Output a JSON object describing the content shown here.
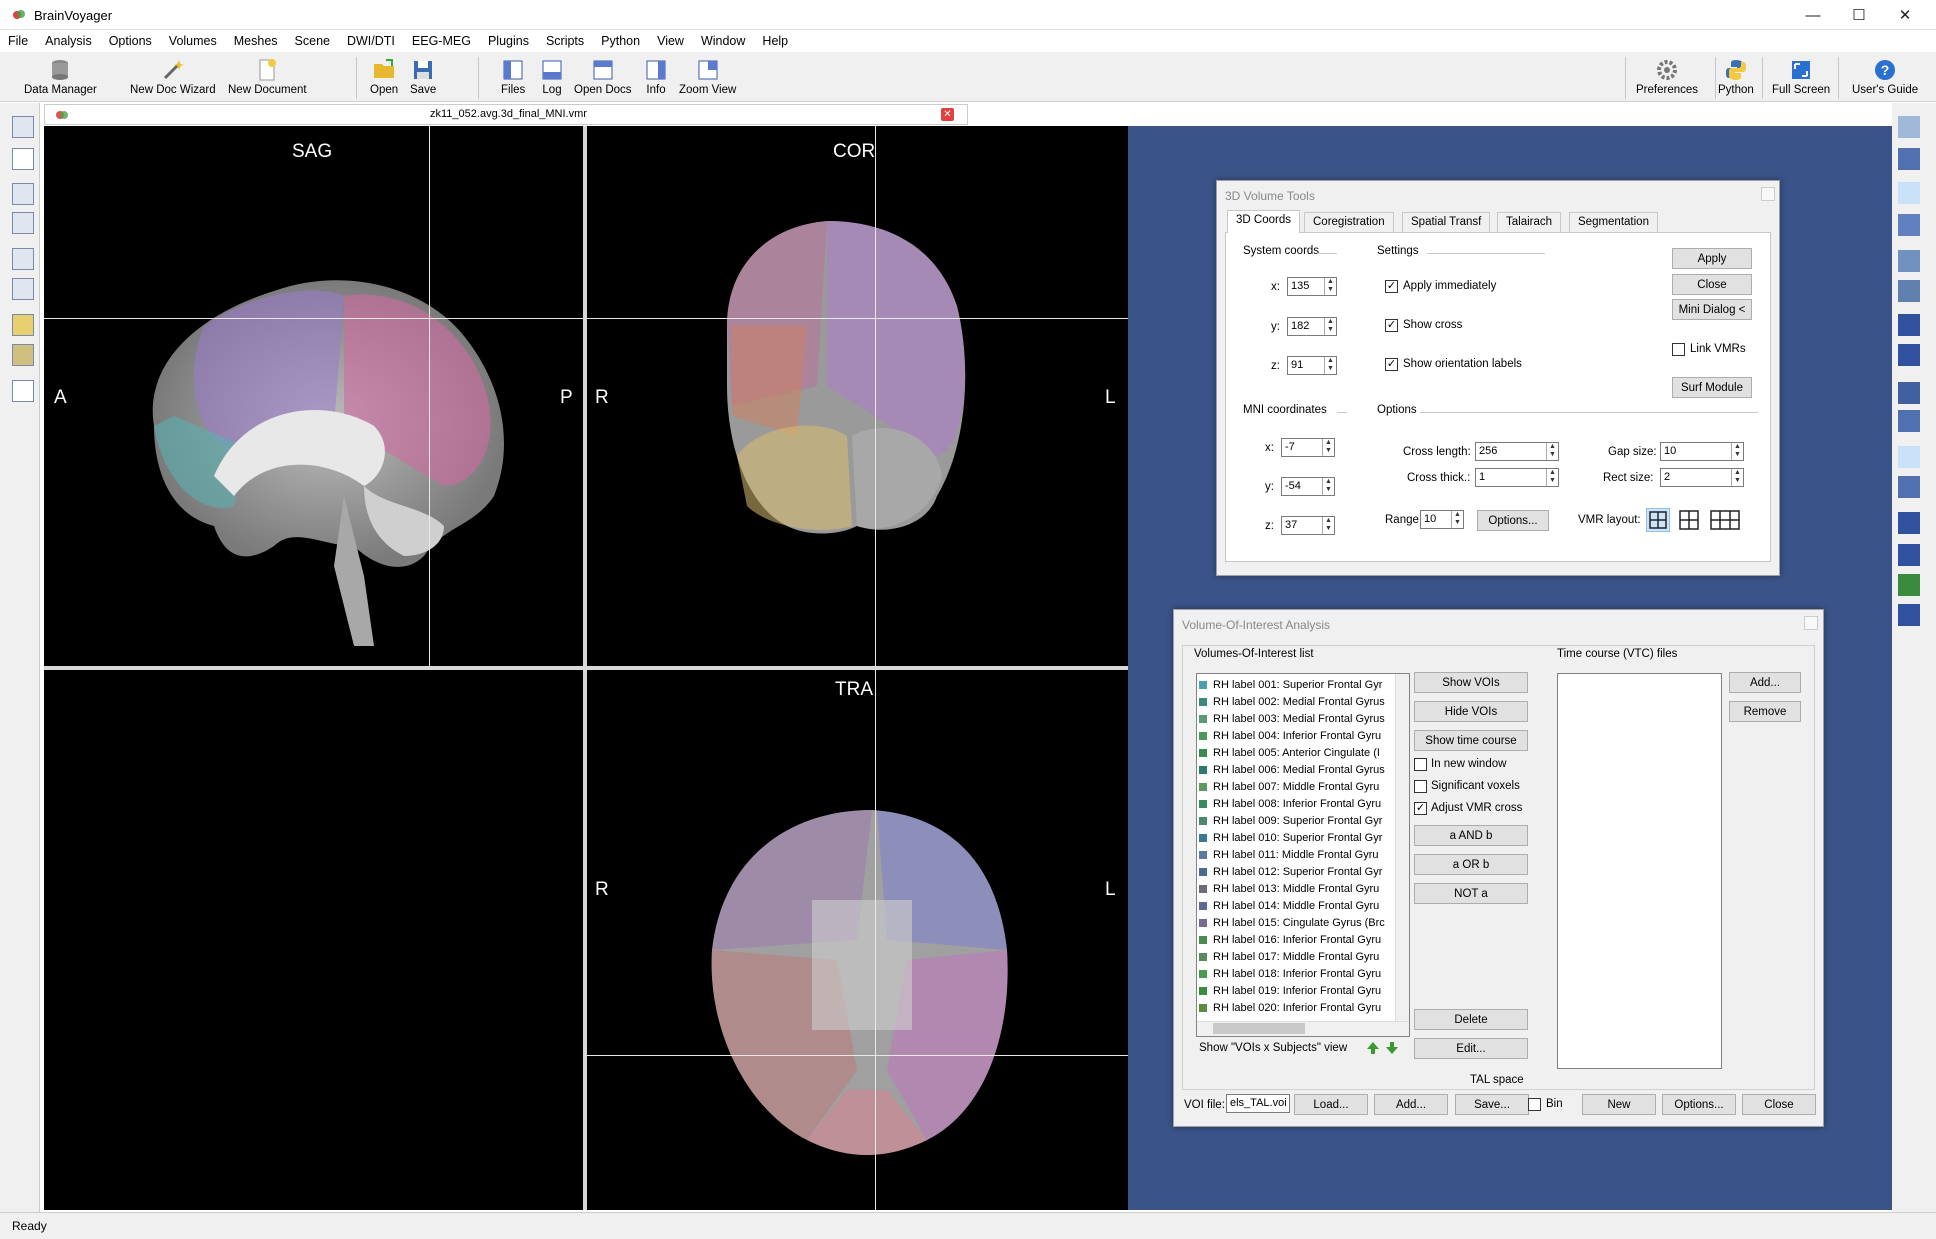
{
  "app": {
    "title": "BrainVoyager"
  },
  "window_controls": {
    "minimize": "—",
    "maximize": "☐",
    "close": "✕"
  },
  "menu": [
    "File",
    "Analysis",
    "Options",
    "Volumes",
    "Meshes",
    "Scene",
    "DWI/DTI",
    "EEG-MEG",
    "Plugins",
    "Scripts",
    "Python",
    "View",
    "Window",
    "Help"
  ],
  "toolbar": {
    "data_manager": "Data Manager",
    "new_doc_wizard": "New Doc Wizard",
    "new_document": "New Document",
    "open": "Open",
    "save": "Save",
    "files": "Files",
    "log": "Log",
    "open_docs": "Open Docs",
    "info": "Info",
    "zoom_view": "Zoom View",
    "preferences": "Preferences",
    "python": "Python",
    "full_screen": "Full Screen",
    "users_guide": "User's Guide"
  },
  "document": {
    "tab_title": "zk11_052.avg.3d_final_MNI.vmr"
  },
  "views": {
    "sag": {
      "title": "SAG",
      "left": "A",
      "right": "P"
    },
    "cor": {
      "title": "COR",
      "left": "R",
      "right": "L"
    },
    "tra": {
      "title": "TRA",
      "left": "R",
      "right": "L"
    }
  },
  "volume_tools": {
    "title": "3D Volume Tools",
    "tabs": [
      "3D Coords",
      "Coregistration",
      "Spatial Transf",
      "Talairach",
      "Segmentation"
    ],
    "active_tab": "3D Coords",
    "system_coords_label": "System coords",
    "settings_label": "Settings",
    "sys": {
      "x_label": "x:",
      "x": "135",
      "y_label": "y:",
      "y": "182",
      "z_label": "z:",
      "z": "91"
    },
    "apply_immediately": "Apply immediately",
    "show_cross": "Show cross",
    "show_orientation_labels": "Show orientation labels",
    "apply": "Apply",
    "close": "Close",
    "mini_dialog": "Mini Dialog <",
    "link_vmrs": "Link VMRs",
    "surf_module": "Surf Module",
    "mni_label": "MNI coordinates",
    "options_label": "Options",
    "mni": {
      "x_label": "x:",
      "x": "-7",
      "y_label": "y:",
      "y": "-54",
      "z_label": "z:",
      "z": "37"
    },
    "cross_length_label": "Cross length:",
    "cross_length": "256",
    "cross_thick_label": "Cross thick.:",
    "cross_thick": "1",
    "gap_size_label": "Gap size:",
    "gap_size": "10",
    "rect_size_label": "Rect size:",
    "rect_size": "2",
    "range_label": "Range:",
    "range": "10",
    "options_button": "Options...",
    "vmr_layout_label": "VMR layout:"
  },
  "voi_analysis": {
    "title": "Volume-Of-Interest Analysis",
    "voi_list_label": "Volumes-Of-Interest list",
    "tc_label": "Time course (VTC) files",
    "vois": [
      {
        "label": "RH label 001: Superior Frontal Gyr",
        "color": "#4aa0b0"
      },
      {
        "label": "RH label 002: Medial Frontal Gyrus",
        "color": "#3a8a80"
      },
      {
        "label": "RH label 003: Medial Frontal Gyrus",
        "color": "#5a9a70"
      },
      {
        "label": "RH label 004: Inferior Frontal Gyru",
        "color": "#4a9a60"
      },
      {
        "label": "RH label 005: Anterior Cingulate (I",
        "color": "#3a8a50"
      },
      {
        "label": "RH label 006: Medial Frontal Gyrus",
        "color": "#2a7a70"
      },
      {
        "label": "RH label 007: Middle Frontal Gyru",
        "color": "#5a9a60"
      },
      {
        "label": "RH label 008: Inferior Frontal Gyru",
        "color": "#3a8a60"
      },
      {
        "label": "RH label 009: Superior Frontal Gyr",
        "color": "#4a8a70"
      },
      {
        "label": "RH label 010: Superior Frontal Gyr",
        "color": "#3a7a90"
      },
      {
        "label": "RH label 011: Middle Frontal Gyru",
        "color": "#5a7aa0"
      },
      {
        "label": "RH label 012: Superior Frontal Gyr",
        "color": "#4a6a90"
      },
      {
        "label": "RH label 013: Middle Frontal Gyru",
        "color": "#6a6a80"
      },
      {
        "label": "RH label 014: Middle Frontal Gyru",
        "color": "#5a6a90"
      },
      {
        "label": "RH label 015: Cingulate Gyrus (Brc",
        "color": "#7a6a90"
      },
      {
        "label": "RH label 016: Inferior Frontal Gyru",
        "color": "#4a8a50"
      },
      {
        "label": "RH label 017: Middle Frontal Gyru",
        "color": "#5a8a60"
      },
      {
        "label": "RH label 018: Inferior Frontal Gyru",
        "color": "#4a9a50"
      },
      {
        "label": "RH label 019: Inferior Frontal Gyru",
        "color": "#3a8a40"
      },
      {
        "label": "RH label 020: Inferior Frontal Gyru",
        "color": "#5a8a40"
      }
    ],
    "show_vois": "Show VOIs",
    "hide_vois": "Hide VOIs",
    "show_time_course": "Show time course",
    "in_new_window": "In new window",
    "significant_voxels": "Significant voxels",
    "adjust_vmr_cross": "Adjust VMR cross",
    "a_and_b": "a AND b",
    "a_or_b": "a OR b",
    "not_a": "NOT a",
    "delete": "Delete",
    "edit": "Edit...",
    "show_vois_subjects": "Show \"VOIs x Subjects\" view",
    "add": "Add...",
    "remove": "Remove",
    "tal_space": "TAL space",
    "voi_file_label": "VOI file:",
    "voi_file_value": "els_TAL.voi",
    "load": "Load...",
    "add2": "Add...",
    "save": "Save...",
    "bin": "Bin",
    "new": "New",
    "options": "Options...",
    "close": "Close"
  },
  "status": {
    "text": "Ready"
  },
  "colors": {
    "desktop": "#3a5489",
    "accent": "#0078d7"
  }
}
